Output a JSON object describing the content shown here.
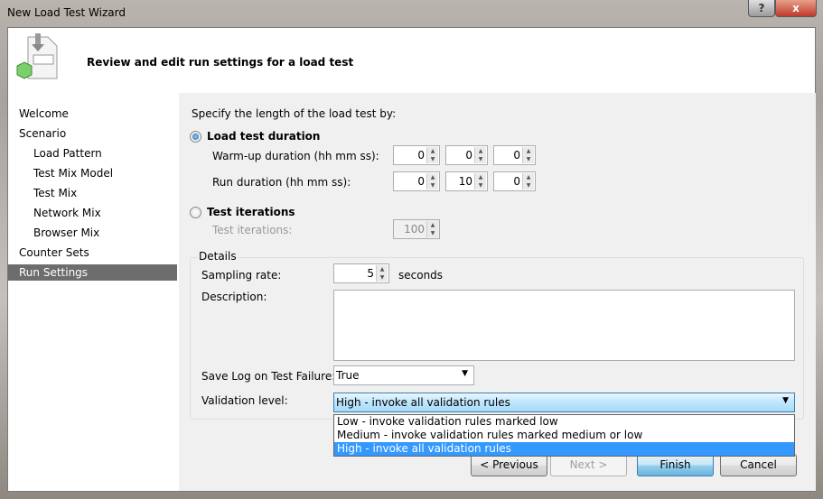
{
  "window": {
    "title": "New Load Test Wizard",
    "help_label": "?",
    "close_label": "x"
  },
  "header": {
    "text": "Review and edit run settings for a load test"
  },
  "nav": {
    "items": [
      {
        "label": "Welcome",
        "level": 0
      },
      {
        "label": "Scenario",
        "level": 0
      },
      {
        "label": "Load Pattern",
        "level": 1
      },
      {
        "label": "Test Mix Model",
        "level": 1
      },
      {
        "label": "Test Mix",
        "level": 1
      },
      {
        "label": "Network Mix",
        "level": 1
      },
      {
        "label": "Browser Mix",
        "level": 1
      },
      {
        "label": "Counter Sets",
        "level": 0
      },
      {
        "label": "Run Settings",
        "level": 0,
        "selected": true
      }
    ]
  },
  "length": {
    "prompt": "Specify the length of the load test by:",
    "duration_option": "Load test duration",
    "duration_selected": true,
    "warmup_label": "Warm-up duration (hh mm ss):",
    "warmup": [
      "0",
      "0",
      "0"
    ],
    "run_label": "Run duration (hh mm ss):",
    "run": [
      "0",
      "10",
      "0"
    ],
    "iterations_option": "Test iterations",
    "iterations_label": "Test iterations:",
    "iterations_value": "100"
  },
  "details": {
    "legend": "Details",
    "sampling_label": "Sampling rate:",
    "sampling_value": "5",
    "sampling_unit": "seconds",
    "description_label": "Description:",
    "description_value": "",
    "savelog_label": "Save Log on Test Failure:",
    "savelog_value": "True",
    "validation_label": "Validation level:",
    "validation_value": "High - invoke all validation rules",
    "validation_options": [
      "Low - invoke validation rules marked low",
      "Medium - invoke validation rules marked medium or low",
      "High - invoke all validation rules"
    ]
  },
  "buttons": {
    "previous": "< Previous",
    "next": "Next >",
    "finish": "Finish",
    "cancel": "Cancel"
  }
}
